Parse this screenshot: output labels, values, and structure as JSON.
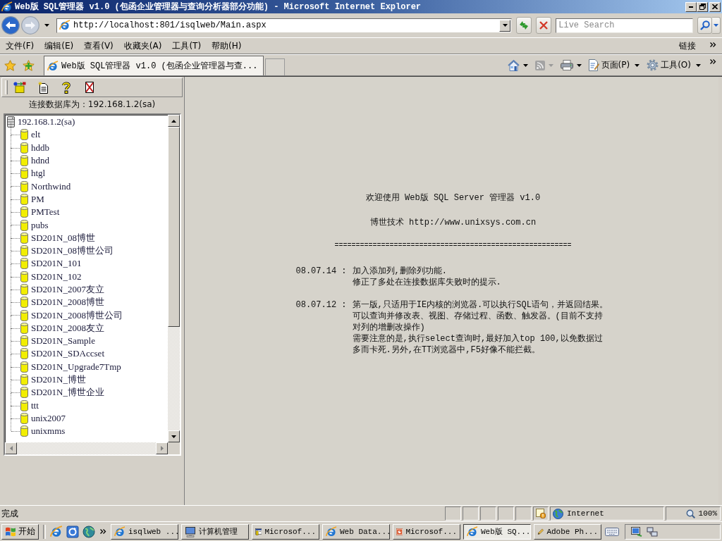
{
  "window": {
    "title": "Web版 SQL管理器 v1.0 (包函企业管理器与查询分析器部分功能) - Microsoft Internet Explorer"
  },
  "address_bar": {
    "url": "http://localhost:801/isqlweb/Main.aspx"
  },
  "search_box": {
    "placeholder": "Live Search"
  },
  "menu_bar": {
    "items": [
      "文件(F)",
      "编辑(E)",
      "查看(V)",
      "收藏夹(A)",
      "工具(T)",
      "帮助(H)"
    ],
    "links": "链接"
  },
  "tabs": [
    {
      "label": "Web版 SQL管理器 v1.0 (包函企业管理器与查...",
      "selected": true
    }
  ],
  "command_bar": {
    "items": [
      "页面(P)",
      "工具(O)"
    ]
  },
  "left_frame": {
    "connection": "连接数据库为：192.168.1.2(sa)",
    "tree": {
      "label": "192.168.1.2(sa)",
      "children": [
        {
          "label": "elt"
        },
        {
          "label": "hddb"
        },
        {
          "label": "hdnd"
        },
        {
          "label": "htgl"
        },
        {
          "label": "Northwind"
        },
        {
          "label": "PM"
        },
        {
          "label": "PMTest"
        },
        {
          "label": "pubs"
        },
        {
          "label": "SD201N_08博世"
        },
        {
          "label": "SD201N_08博世公司"
        },
        {
          "label": "SD201N_101"
        },
        {
          "label": "SD201N_102"
        },
        {
          "label": "SD201N_2007友立"
        },
        {
          "label": "SD201N_2008博世"
        },
        {
          "label": "SD201N_2008博世公司"
        },
        {
          "label": "SD201N_2008友立"
        },
        {
          "label": "SD201N_Sample"
        },
        {
          "label": "SD201N_SDAccset"
        },
        {
          "label": "SD201N_Upgrade7Tmp"
        },
        {
          "label": "SD201N_博世"
        },
        {
          "label": "SD201N_博世企业"
        },
        {
          "label": "ttt"
        },
        {
          "label": "unix2007"
        },
        {
          "label": "unixmms"
        }
      ]
    }
  },
  "main_frame": {
    "heading": "欢迎使用 Web版 SQL Server 管理器 v1.0",
    "company": "博世技术 http://www.unixsys.com.cn",
    "separator": "========================================================",
    "changelog": [
      {
        "date": "08.07.14 :",
        "paragraphs": [
          "加入添加列,删除列功能.",
          "修正了多处在连接数据库失败时的提示."
        ]
      },
      {
        "date": "08.07.12 :",
        "paragraphs": [
          "第一版,只适用于IE内核的浏览器.可以执行SQL语句，并返回结果。",
          "可以查询并修改表、视图、存储过程、函数、触发器。(目前不支持对列的增删改操作)",
          "需要注意的是,执行select查询时,最好加入top 100,以免数据过多而卡死.另外,在TT浏览器中,F5好像不能拦截。"
        ]
      }
    ]
  },
  "status_bar": {
    "text": "完成",
    "zone": "Internet",
    "zoom": "100%"
  },
  "taskbar": {
    "start": "开始",
    "tasks": [
      {
        "label": "isqlweb ...",
        "selected": false
      },
      {
        "label": "计算机管理",
        "selected": false
      },
      {
        "label": "Microsof...",
        "selected": false
      },
      {
        "label": "Web Data...",
        "selected": false
      },
      {
        "label": "Microsof...",
        "selected": false
      },
      {
        "label": "Web版 SQ...",
        "selected": true
      },
      {
        "label": "Adobe Ph...",
        "selected": false
      }
    ]
  }
}
